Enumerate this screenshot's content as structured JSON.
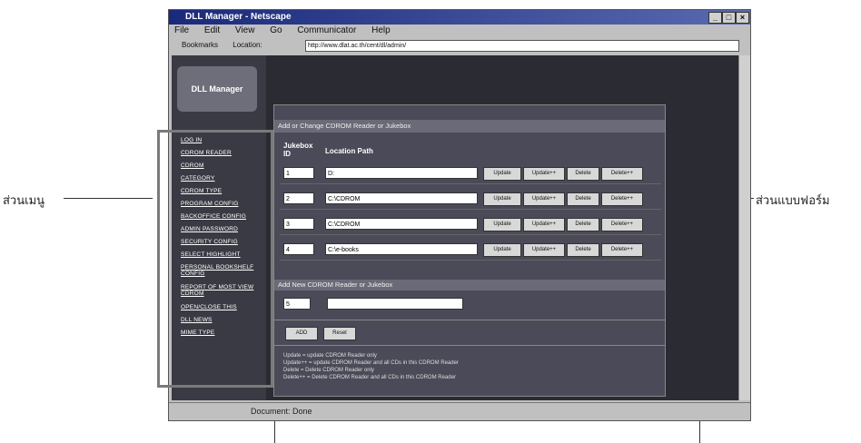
{
  "annotations": {
    "menu_label": "ส่วนเมนู",
    "form_label": "ส่วนแบบฟอร์ม"
  },
  "window": {
    "title": "DLL Manager - Netscape",
    "menu": [
      "File",
      "Edit",
      "View",
      "Go",
      "Communicator",
      "Help"
    ],
    "toolbar_bookmarks": "Bookmarks",
    "toolbar_location": "Location:",
    "url": "http://www.dlat.ac.th/cent/dl/admin/",
    "status": "Document: Done"
  },
  "sidebar": {
    "logo_text": "DLL Manager",
    "items": [
      "LOG IN",
      "CDROM READER",
      "CDROM",
      "CATEGORY",
      "CDROM TYPE",
      "PROGRAM CONFIG",
      "BACKOFFICE CONFIG",
      "ADMIN PASSWORD",
      "SECURITY CONFIG",
      "SELECT HIGHLIGHT",
      "PERSONAL BOOKSHELF CONFIG",
      "REPORT OF MOST VIEW CDROM",
      "OPEN/CLOSE THIS",
      "DLL NEWS",
      "MIME TYPE"
    ]
  },
  "form": {
    "title": "Add or Change CDROM Reader or Jukebox",
    "col_id": "Jukebox ID",
    "col_path": "Location Path",
    "rows": [
      {
        "id": "1",
        "path": "D:"
      },
      {
        "id": "2",
        "path": "C:\\CDROM"
      },
      {
        "id": "3",
        "path": "C:\\CDROM"
      },
      {
        "id": "4",
        "path": "C:\\e-books"
      }
    ],
    "btn_update": "Update",
    "btn_update_all": "Update++",
    "btn_delete": "Delete",
    "btn_delete_all": "Delete++",
    "add_title": "Add New CDROM Reader or Jukebox",
    "new_id": "5",
    "new_path": "",
    "btn_add": "ADD",
    "btn_reset": "Reset",
    "legend": [
      "Update = update CDROM Reader only",
      "Update++ = update CDROM Reader and all CDs in this CDROM Reader",
      "Delete = Delete CDROM Reader only",
      "Delete++ = Delete CDROM Reader and all CDs in this CDROM Reader"
    ]
  }
}
